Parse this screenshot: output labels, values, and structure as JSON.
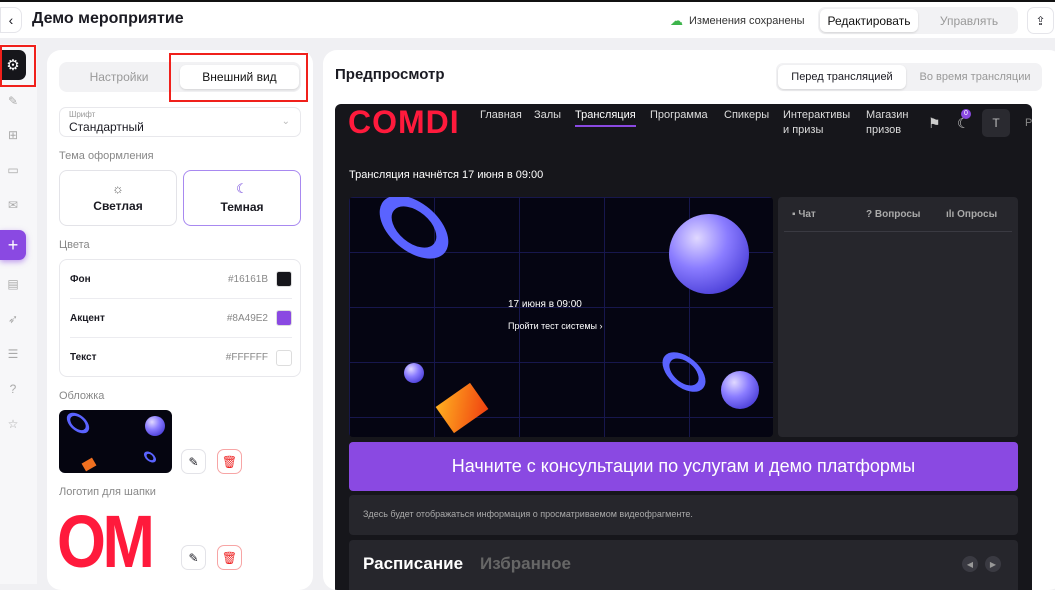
{
  "header": {
    "title": "Демо мероприятие",
    "saved": "Изменения сохранены",
    "modes": [
      "Редактировать",
      "Управлять"
    ]
  },
  "panel": {
    "tabs": [
      "Настройки",
      "Внешний вид"
    ],
    "font": {
      "label": "Шрифт",
      "value": "Стандартный"
    },
    "theme_label": "Тема оформления",
    "themes": [
      "Светлая",
      "Темная"
    ],
    "colors_label": "Цвета",
    "colors": [
      {
        "name": "Фон",
        "hex": "#16161B"
      },
      {
        "name": "Акцент",
        "hex": "#8A49E2"
      },
      {
        "name": "Текст",
        "hex": "#FFFFFF"
      }
    ],
    "cover_label": "Обложка",
    "logo_label": "Логотип для шапки",
    "logo_text": "OM"
  },
  "preview": {
    "title": "Предпросмотр",
    "tabs": [
      "Перед трансляцией",
      "Во время трансляции"
    ],
    "site": {
      "brand": "COMDI",
      "nav": [
        "Главная",
        "Залы",
        "Трансляция",
        "Программа",
        "Спикеры",
        "Интерактивы\nи призы",
        "Магазин\nпризов"
      ],
      "badge": "0",
      "avatar": "T",
      "cut": "P",
      "starts": "Трансляция начнётся 17 июня в 09:00",
      "video_date": "17 июня в 09:00",
      "video_test": "Пройти тест системы",
      "chat_tabs": [
        "Чат",
        "Вопросы",
        "Опросы"
      ],
      "banner": "Начните с консультации по услугам и демо платформы",
      "info": "Здесь будет отображаться информация о просматриваемом видеофрагменте.",
      "schedule": [
        "Расписание",
        "Избранное"
      ]
    }
  }
}
